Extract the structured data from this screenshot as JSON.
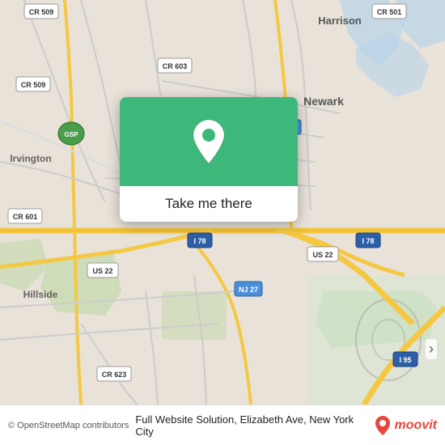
{
  "map": {
    "background_color": "#e8e0d8",
    "center_lat": 40.7282,
    "center_lng": -74.1776
  },
  "popup": {
    "take_me_there_label": "Take me there",
    "green_color": "#3db87a",
    "pin_color": "white"
  },
  "bottom_bar": {
    "copyright": "© OpenStreetMap contributors",
    "address": "Full Website Solution, Elizabeth Ave, New York City",
    "moovit_label": "moovit"
  },
  "road_labels": [
    "CR 509",
    "CR 509",
    "CR 603",
    "CR 501",
    "NJ 21",
    "I 78",
    "US 22",
    "I 78",
    "US 22",
    "NJ 27",
    "CR 601",
    "CR 623",
    "GSP",
    "I 95"
  ],
  "place_labels": [
    "Harrison",
    "Newark",
    "Irvington",
    "Hillside"
  ],
  "scroll_hint": "›"
}
